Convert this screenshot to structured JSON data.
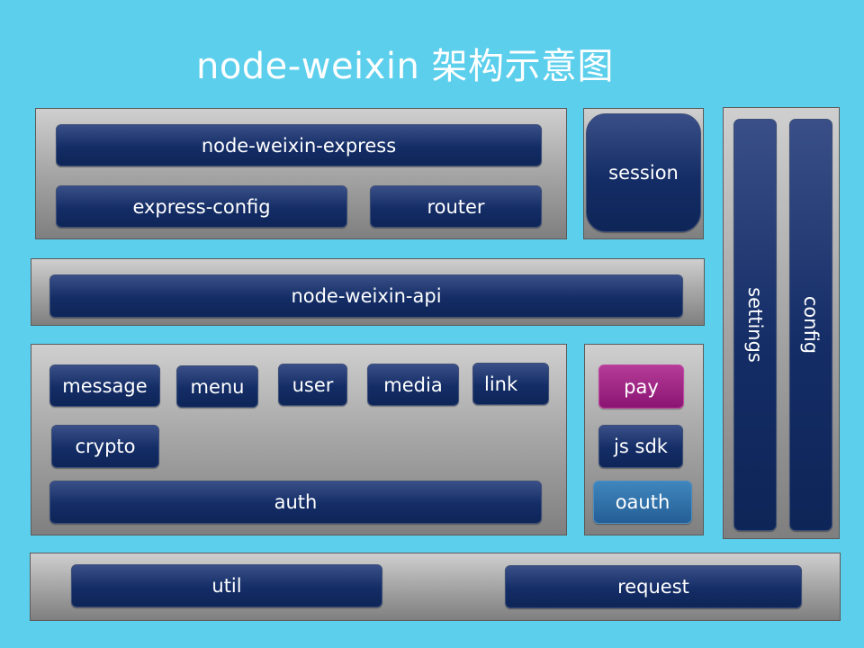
{
  "title": "node-weixin 架构示意图",
  "modules": {
    "express": "node-weixin-express",
    "express_config": "express-config",
    "router": "router",
    "session": "session",
    "api": "node-weixin-api",
    "message": "message",
    "menu": "menu",
    "user": "user",
    "media": "media",
    "link": "link",
    "crypto": "crypto",
    "auth": "auth",
    "pay": "pay",
    "js_sdk": "js sdk",
    "oauth": "oauth",
    "settings": "settings",
    "config": "config",
    "util": "util",
    "request": "request"
  },
  "colors": {
    "background": "#5ccfec",
    "module": "#142d66",
    "pay": "#8b1473",
    "oauth": "#245e96"
  }
}
